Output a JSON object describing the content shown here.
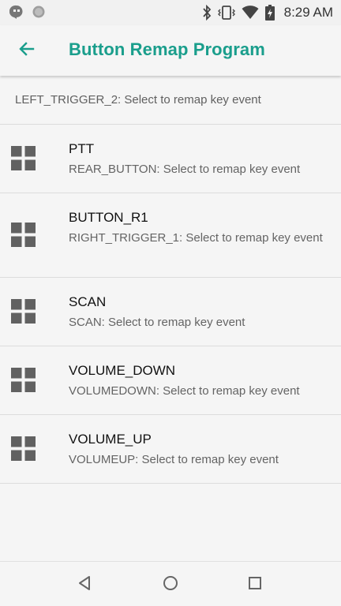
{
  "status_bar": {
    "time": "8:29 AM",
    "icons": [
      "hangouts-icon",
      "sync-icon",
      "bluetooth-icon",
      "vibrate-icon",
      "wifi-icon",
      "battery-icon"
    ]
  },
  "app_bar": {
    "title": "Button Remap Program",
    "back_icon": "arrow-left-icon"
  },
  "header": {
    "summary": "LEFT_TRIGGER_2: Select to remap key event"
  },
  "items": [
    {
      "title": "PTT",
      "summary": "REAR_BUTTON: Select to remap key event",
      "icon": "grid-icon"
    },
    {
      "title": "BUTTON_R1",
      "summary": "RIGHT_TRIGGER_1: Select to remap key event",
      "icon": "grid-icon"
    },
    {
      "title": "SCAN",
      "summary": "SCAN: Select to remap key event",
      "icon": "grid-icon"
    },
    {
      "title": "VOLUME_DOWN",
      "summary": "VOLUMEDOWN: Select to remap key event",
      "icon": "grid-icon"
    },
    {
      "title": "VOLUME_UP",
      "summary": "VOLUMEUP: Select to remap key event",
      "icon": "grid-icon"
    }
  ],
  "nav_bar": {
    "icons": [
      "back-triangle-icon",
      "home-circle-icon",
      "recents-square-icon"
    ]
  },
  "colors": {
    "accent": "#1a9e8c",
    "background": "#f5f5f5",
    "icon_gray": "#616161"
  }
}
